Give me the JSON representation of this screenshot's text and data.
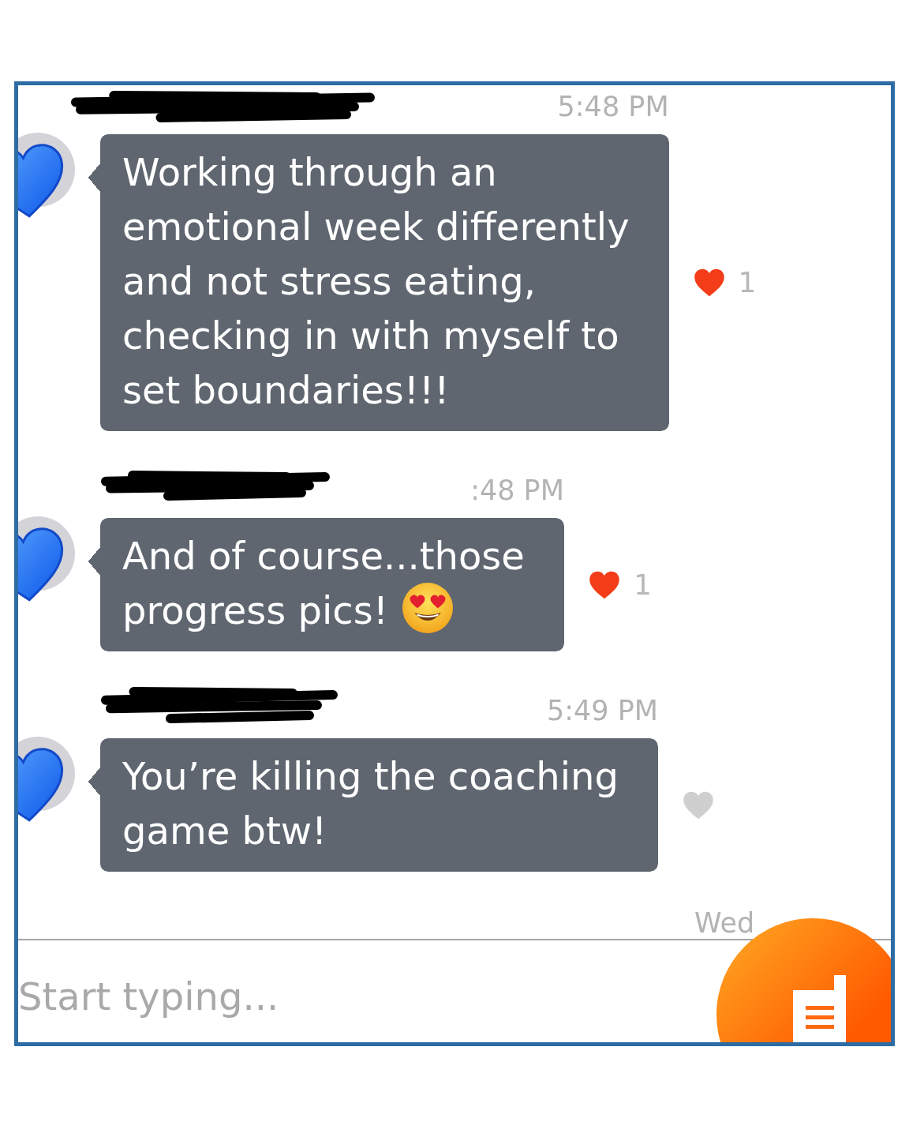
{
  "messages": [
    {
      "sender": {
        "redacted": true
      },
      "time": "5:48 PM",
      "lines": [
        "Working through an",
        "emotional week differently",
        "and not stress eating,",
        "checking in with myself to",
        "set boundaries!!!"
      ],
      "trailing_emoji": false,
      "reaction": {
        "liked": true,
        "count": "1"
      }
    },
    {
      "sender": {
        "redacted": true
      },
      "time": ":48 PM",
      "lines": [
        "And of course...those",
        "progress pics!"
      ],
      "trailing_emoji": true,
      "reaction": {
        "liked": true,
        "count": "1"
      }
    },
    {
      "sender": {
        "redacted": true
      },
      "time": "5:49 PM",
      "lines": [
        "You’re killing the coaching",
        "game btw!"
      ],
      "trailing_emoji": false,
      "reaction": {
        "liked": false
      }
    }
  ],
  "day_label": "Wed",
  "composer": {
    "placeholder": "Start typing..."
  }
}
